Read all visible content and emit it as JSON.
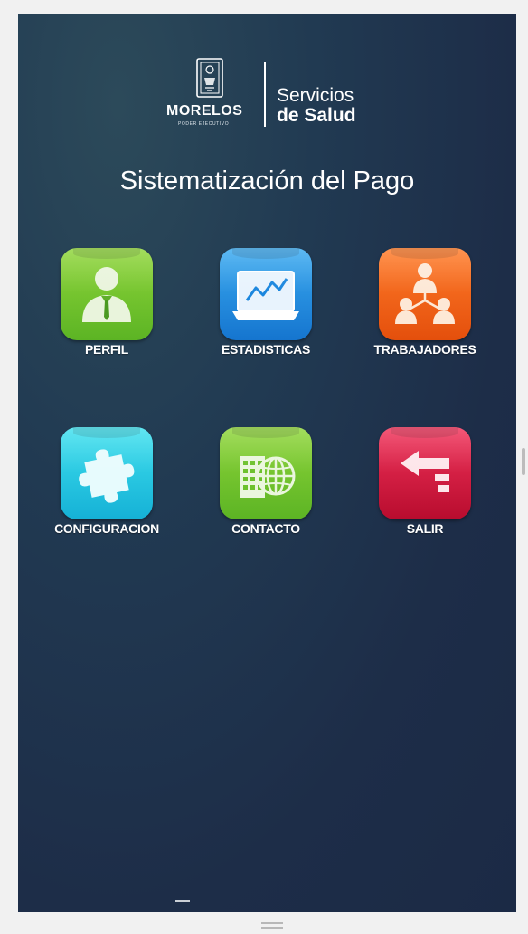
{
  "header": {
    "logo": {
      "state_name": "MORELOS",
      "state_sub": "PODER EJECUTIVO",
      "org_line1": "Servicios",
      "org_line2": "de Salud"
    },
    "title": "Sistematización del Pago"
  },
  "menu": {
    "items": [
      {
        "label": "PERFIL",
        "icon": "user-profile-icon",
        "color": "#6cc12c"
      },
      {
        "label": "ESTADISTICAS",
        "icon": "statistics-chart-icon",
        "color": "#1e8fe3"
      },
      {
        "label": "TRABAJADORES",
        "icon": "workers-hierarchy-icon",
        "color": "#f2651a"
      },
      {
        "label": "CONFIGURACION",
        "icon": "puzzle-piece-icon",
        "color": "#24c9e2"
      },
      {
        "label": "CONTACTO",
        "icon": "building-globe-icon",
        "color": "#6cc12c"
      },
      {
        "label": "SALIR",
        "icon": "exit-arrow-icon",
        "color": "#dc1c44"
      }
    ]
  },
  "colors": {
    "background": "#1f3049",
    "title_text": "#ffffff"
  }
}
